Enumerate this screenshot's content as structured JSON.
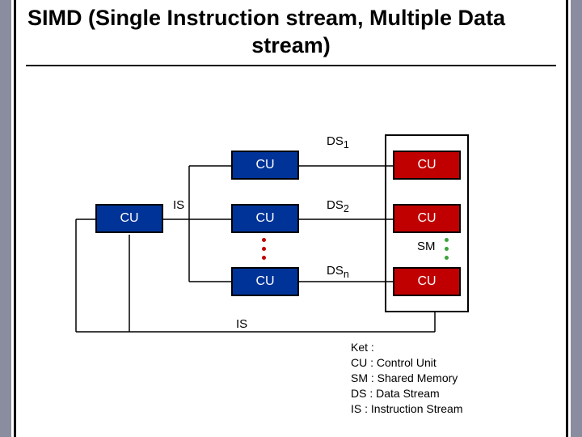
{
  "title": {
    "line1": "SIMD (Single Instruction stream, Multiple Data",
    "line2": "stream)"
  },
  "nodes": {
    "cu_main": "CU",
    "pu1": "CU",
    "pu2": "CU",
    "pun": "CU",
    "mm1": "CU",
    "mm2": "CU",
    "mmn": "CU"
  },
  "labels": {
    "is_left": "IS",
    "is_bottom": "IS",
    "ds1": "DS",
    "ds1_sub": "1",
    "ds2": "DS",
    "ds2_sub": "2",
    "dsn": "DS",
    "dsn_sub": "n",
    "sm": "SM"
  },
  "legend": {
    "heading": "Ket :",
    "cu": "CU  : Control Unit",
    "sm": "SM   : Shared Memory",
    "ds": " DS   : Data Stream",
    "is": "IS  : Instruction Stream"
  }
}
